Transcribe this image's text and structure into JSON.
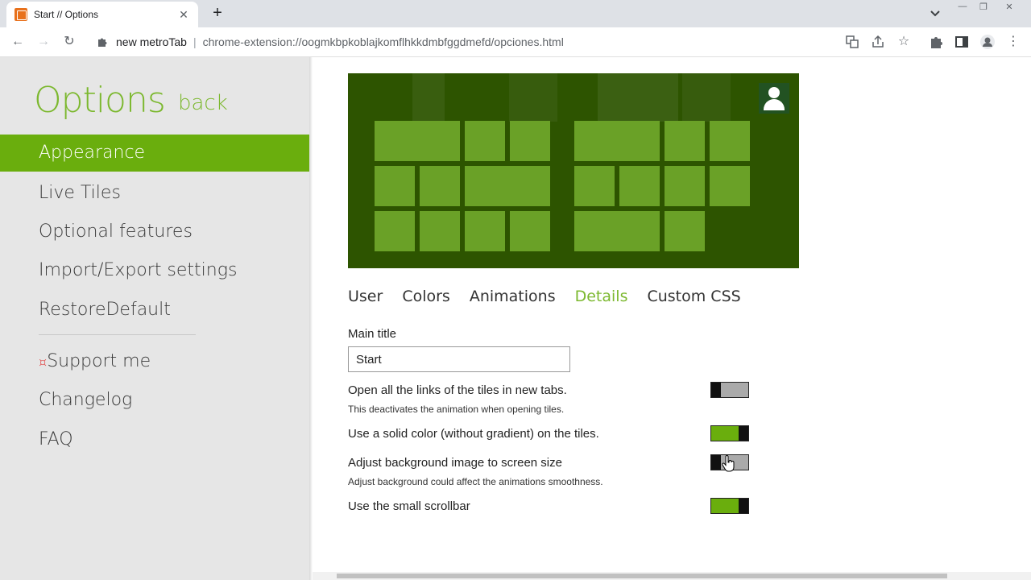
{
  "browser": {
    "tab_title": "Start // Options",
    "omnibox_name": "new metroTab",
    "omnibox_separator": "|",
    "url": "chrome-extension://oogmkbpkoblajkomflhkkdmbfggdmefd/opciones.html"
  },
  "icons": {
    "back": "back-arrow-icon",
    "forward": "forward-arrow-icon",
    "reload": "reload-icon",
    "translate": "translate-icon",
    "share": "share-icon",
    "star": "bookmark-star-icon",
    "extensions": "puzzle-icon",
    "sidepanel": "side-panel-icon",
    "profile": "profile-icon",
    "menu": "kebab-menu-icon"
  },
  "sidebar": {
    "title": "Options",
    "back_label": "back",
    "items": [
      {
        "label": "Appearance",
        "active": true
      },
      {
        "label": "Live Tiles",
        "active": false
      },
      {
        "label": "Optional features",
        "active": false
      },
      {
        "label": "Import/Export settings",
        "active": false
      },
      {
        "label": "RestoreDefault",
        "active": false
      }
    ],
    "support_mark": "¤",
    "support_label": "Support me",
    "changelog_label": "Changelog",
    "faq_label": "FAQ"
  },
  "subtabs": [
    {
      "label": "User",
      "active": false
    },
    {
      "label": "Colors",
      "active": false
    },
    {
      "label": "Animations",
      "active": false
    },
    {
      "label": "Details",
      "active": true
    },
    {
      "label": "Custom CSS",
      "active": false
    }
  ],
  "details": {
    "main_title_label": "Main title",
    "main_title_value": "Start",
    "options": [
      {
        "label": "Open all the links of the tiles in new tabs.",
        "hint": "This deactivates the animation when opening tiles.",
        "enabled": false
      },
      {
        "label": "Use a solid color (without gradient) on the tiles.",
        "hint": "",
        "enabled": true
      },
      {
        "label": "Adjust background image to screen size",
        "hint": "Adjust background could affect the animations smoothness.",
        "enabled": false
      },
      {
        "label": "Use the small scrollbar",
        "hint": "",
        "enabled": true
      }
    ]
  },
  "colors": {
    "accent": "#7cb82f",
    "menu_active": "#6aae0d",
    "preview_bg": "#2d5400",
    "preview_tile": "#6aa127"
  }
}
